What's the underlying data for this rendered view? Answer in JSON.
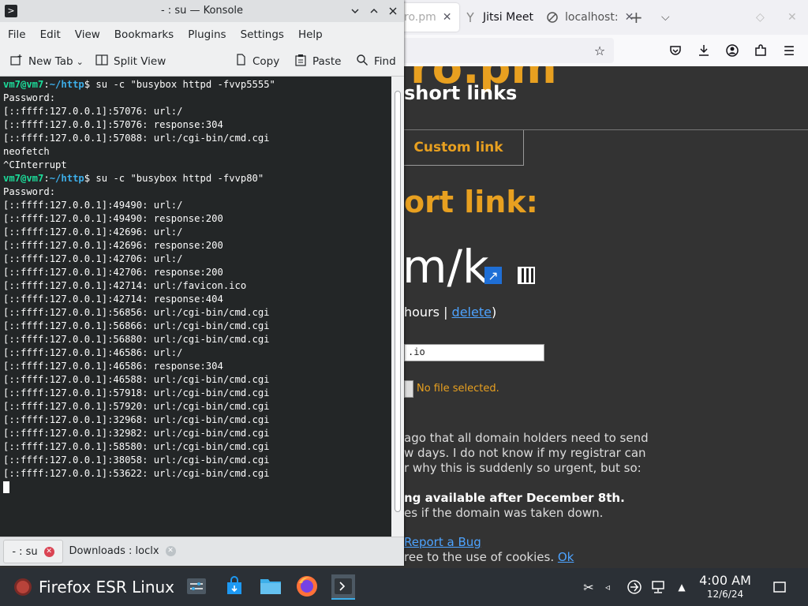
{
  "browser": {
    "tabs": [
      {
        "label": "ro.pm"
      },
      {
        "label": "Jitsi Meet"
      },
      {
        "label": "localhost:"
      }
    ],
    "new_tab_symbol": "+",
    "site": {
      "logo_fragment": "ro.pm",
      "subtitle_fragment": "short links",
      "custom_tab": "Custom link",
      "heading_fragment": "ort link:",
      "short_url_fragment": "m/k",
      "hours_fragment": "hours | ",
      "delete_link": "delete",
      "close_paren": ")",
      "textarea_value": ".io",
      "no_file": "No file selected.",
      "para_lines": [
        "ago that all domain holders need to send",
        "w days. I do not know if my registrar can",
        "r why this is suddenly so urgent, but so:"
      ],
      "bold_line": "ng available after December 8th.",
      "after_bold_line": "es if the domain was taken down.",
      "bug_link": "Report a Bug",
      "cookie_text": "ree to the use of cookies. ",
      "cookie_ok": "Ok"
    }
  },
  "konsole": {
    "title": "- : su — Konsole",
    "menu": [
      "File",
      "Edit",
      "View",
      "Bookmarks",
      "Plugins",
      "Settings",
      "Help"
    ],
    "toolbar": {
      "new_tab": "New Tab",
      "split_view": "Split View",
      "copy": "Copy",
      "paste": "Paste",
      "find": "Find"
    },
    "prompt": {
      "user": "vm7@vm7",
      "sep": ":",
      "path": "~/http",
      "sym": "$"
    },
    "lines": [
      {
        "kind": "cmd",
        "text": " su -c \"busybox httpd -fvvp5555\""
      },
      {
        "kind": "out",
        "text": "Password:"
      },
      {
        "kind": "out",
        "text": "[::ffff:127.0.0.1]:57076: url:/"
      },
      {
        "kind": "out",
        "text": "[::ffff:127.0.0.1]:57076: response:304"
      },
      {
        "kind": "out",
        "text": "[::ffff:127.0.0.1]:57088: url:/cgi-bin/cmd.cgi"
      },
      {
        "kind": "out",
        "text": "neofetch"
      },
      {
        "kind": "out",
        "text": "^CInterrupt"
      },
      {
        "kind": "cmd",
        "text": " su -c \"busybox httpd -fvvp80\""
      },
      {
        "kind": "out",
        "text": "Password:"
      },
      {
        "kind": "out",
        "text": "[::ffff:127.0.0.1]:49490: url:/"
      },
      {
        "kind": "out",
        "text": "[::ffff:127.0.0.1]:49490: response:200"
      },
      {
        "kind": "out",
        "text": "[::ffff:127.0.0.1]:42696: url:/"
      },
      {
        "kind": "out",
        "text": "[::ffff:127.0.0.1]:42696: response:200"
      },
      {
        "kind": "out",
        "text": "[::ffff:127.0.0.1]:42706: url:/"
      },
      {
        "kind": "out",
        "text": "[::ffff:127.0.0.1]:42706: response:200"
      },
      {
        "kind": "out",
        "text": "[::ffff:127.0.0.1]:42714: url:/favicon.ico"
      },
      {
        "kind": "out",
        "text": "[::ffff:127.0.0.1]:42714: response:404"
      },
      {
        "kind": "out",
        "text": "[::ffff:127.0.0.1]:56856: url:/cgi-bin/cmd.cgi"
      },
      {
        "kind": "out",
        "text": "[::ffff:127.0.0.1]:56866: url:/cgi-bin/cmd.cgi"
      },
      {
        "kind": "out",
        "text": "[::ffff:127.0.0.1]:56880: url:/cgi-bin/cmd.cgi"
      },
      {
        "kind": "out",
        "text": "[::ffff:127.0.0.1]:46586: url:/"
      },
      {
        "kind": "out",
        "text": "[::ffff:127.0.0.1]:46586: response:304"
      },
      {
        "kind": "out",
        "text": "[::ffff:127.0.0.1]:46588: url:/cgi-bin/cmd.cgi"
      },
      {
        "kind": "out",
        "text": "[::ffff:127.0.0.1]:57918: url:/cgi-bin/cmd.cgi"
      },
      {
        "kind": "out",
        "text": "[::ffff:127.0.0.1]:57920: url:/cgi-bin/cmd.cgi"
      },
      {
        "kind": "out",
        "text": "[::ffff:127.0.0.1]:32968: url:/cgi-bin/cmd.cgi"
      },
      {
        "kind": "out",
        "text": "[::ffff:127.0.0.1]:32982: url:/cgi-bin/cmd.cgi"
      },
      {
        "kind": "out",
        "text": "[::ffff:127.0.0.1]:58580: url:/cgi-bin/cmd.cgi"
      },
      {
        "kind": "out",
        "text": "[::ffff:127.0.0.1]:38058: url:/cgi-bin/cmd.cgi"
      },
      {
        "kind": "out",
        "text": "[::ffff:127.0.0.1]:53622: url:/cgi-bin/cmd.cgi"
      }
    ],
    "tabs": [
      {
        "label": "- : su"
      },
      {
        "label": "Downloads : loclx"
      }
    ]
  },
  "taskbar": {
    "active_window": "Firefox ESR Linux",
    "clock_time": "4:00 AM",
    "clock_date": "12/6/24"
  },
  "colors": {
    "prompt_user": "#1cdc9a",
    "prompt_path": "#3daee9",
    "site_accent": "#e8a020",
    "terminal_bg": "#232627"
  }
}
